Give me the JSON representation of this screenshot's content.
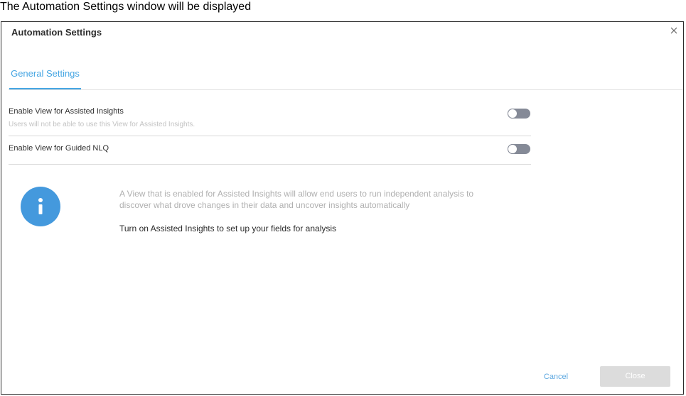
{
  "caption": "The Automation Settings window will be displayed",
  "window": {
    "title": "Automation Settings",
    "close_icon": "close-icon"
  },
  "tabs": [
    {
      "label": "General Settings",
      "active": true
    }
  ],
  "settings": [
    {
      "label": "Enable View for Assisted Insights",
      "description": "Users will not be able to use this View for Assisted Insights.",
      "enabled": false
    },
    {
      "label": "Enable View for Guided NLQ",
      "enabled": false
    }
  ],
  "info": {
    "icon": "info-icon",
    "text_line1": "A View that is enabled for Assisted Insights will allow end users to run independent analysis to",
    "text_line2": "discover what drove changes in their data and uncover insights automatically",
    "call_to_action": "Turn on Assisted Insights to set up your fields for analysis"
  },
  "footer": {
    "cancel_label": "Cancel",
    "close_label": "Close"
  },
  "colors": {
    "accent": "#46a6e3",
    "info_circle": "#4499dd",
    "toggle_off": "#858a97",
    "disabled_button": "#dcdcdc"
  }
}
